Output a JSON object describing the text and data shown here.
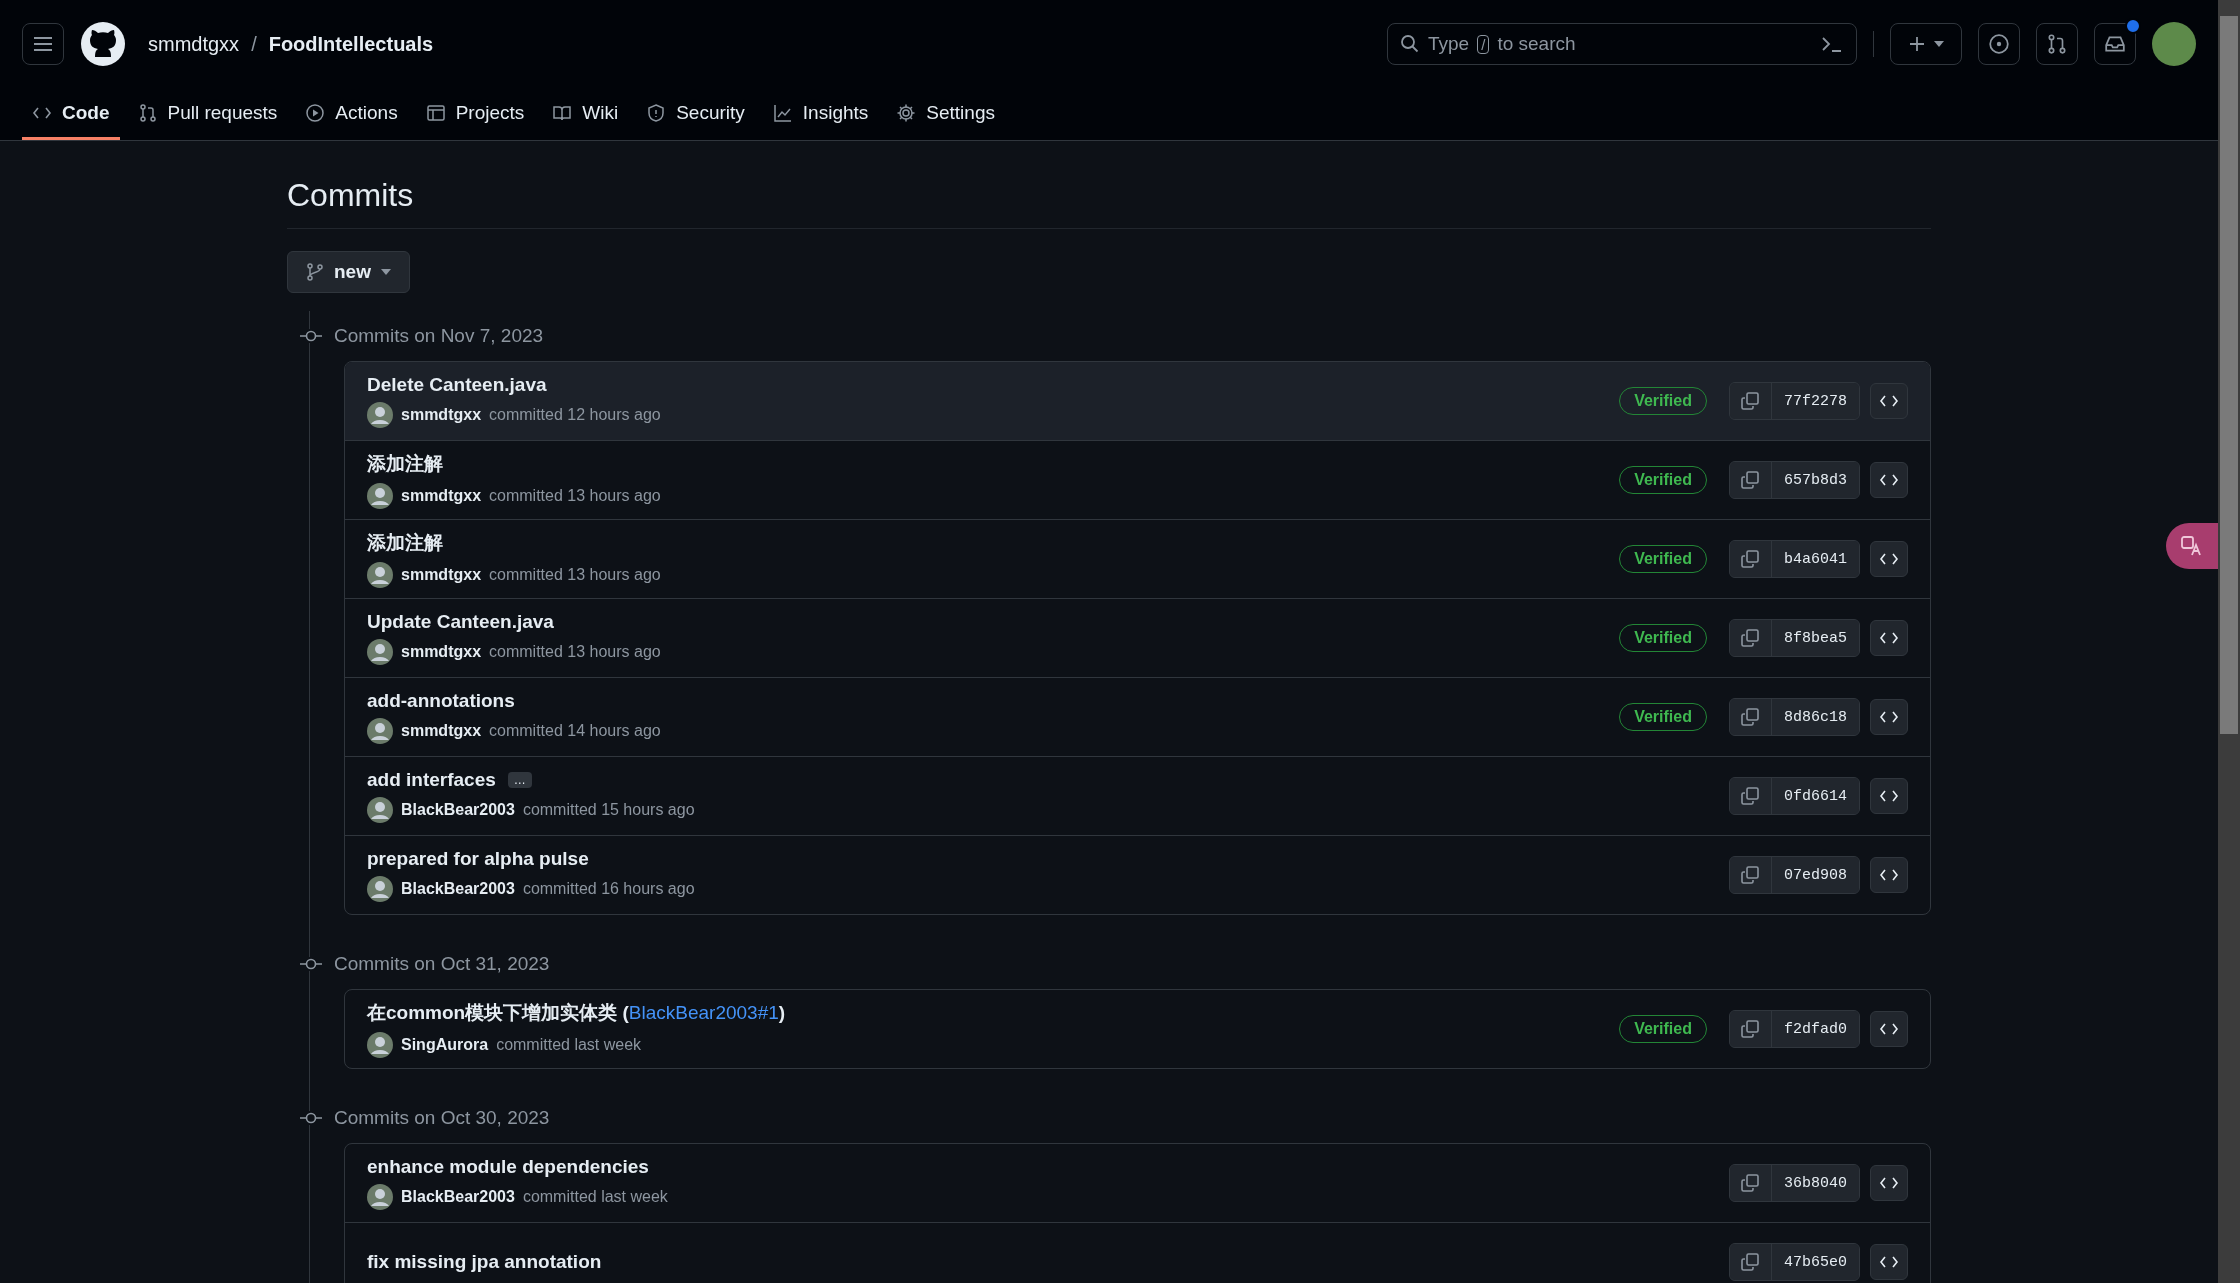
{
  "header": {
    "owner": "smmdtgxx",
    "separator": "/",
    "repo": "FoodIntellectuals",
    "search": {
      "placeholder_prefix": "Type",
      "key": "/",
      "placeholder_suffix": "to search"
    },
    "notification_dot": true
  },
  "tabs": [
    {
      "label": "Code",
      "selected": true
    },
    {
      "label": "Pull requests",
      "selected": false
    },
    {
      "label": "Actions",
      "selected": false
    },
    {
      "label": "Projects",
      "selected": false
    },
    {
      "label": "Wiki",
      "selected": false
    },
    {
      "label": "Security",
      "selected": false
    },
    {
      "label": "Insights",
      "selected": false
    },
    {
      "label": "Settings",
      "selected": false
    }
  ],
  "page": {
    "title": "Commits",
    "branch": "new"
  },
  "groups": [
    {
      "date": "Commits on Nov 7, 2023",
      "commits": [
        {
          "message": "Delete Canteen.java",
          "author": "smmdtgxx",
          "action": "committed",
          "time": "12 hours ago",
          "badge": "Verified",
          "sha": "77f2278",
          "highlighted": true
        },
        {
          "message": "添加注解",
          "author": "smmdtgxx",
          "action": "committed",
          "time": "13 hours ago",
          "badge": "Verified",
          "sha": "657b8d3",
          "highlighted": false
        },
        {
          "message": "添加注解",
          "author": "smmdtgxx",
          "action": "committed",
          "time": "13 hours ago",
          "badge": "Verified",
          "sha": "b4a6041",
          "highlighted": false
        },
        {
          "message": "Update Canteen.java",
          "author": "smmdtgxx",
          "action": "committed",
          "time": "13 hours ago",
          "badge": "Verified",
          "sha": "8f8bea5",
          "highlighted": false
        },
        {
          "message": "add-annotations",
          "author": "smmdtgxx",
          "action": "committed",
          "time": "14 hours ago",
          "badge": "Verified",
          "sha": "8d86c18",
          "highlighted": false
        },
        {
          "message": "add interfaces",
          "more": "…",
          "author": "BlackBear2003",
          "action": "committed",
          "time": "15 hours ago",
          "sha": "0fd6614",
          "highlighted": false
        },
        {
          "message": "prepared for alpha pulse",
          "author": "BlackBear2003",
          "action": "committed",
          "time": "16 hours ago",
          "sha": "07ed908",
          "highlighted": false
        }
      ]
    },
    {
      "date": "Commits on Oct 31, 2023",
      "commits": [
        {
          "message": "在common模块下增加实体类 (",
          "link": "BlackBear2003#1",
          "message_end": ")",
          "author": "SingAurora",
          "action": "committed",
          "time": "last week",
          "badge": "Verified",
          "sha": "f2dfad0",
          "highlighted": false
        }
      ]
    },
    {
      "date": "Commits on Oct 30, 2023",
      "commits": [
        {
          "message": "enhance module dependencies",
          "author": "BlackBear2003",
          "action": "committed",
          "time": "last week",
          "sha": "36b8040",
          "highlighted": false
        },
        {
          "message": "fix missing jpa annotation",
          "sha": "47b65e0",
          "highlighted": false
        }
      ]
    }
  ]
}
